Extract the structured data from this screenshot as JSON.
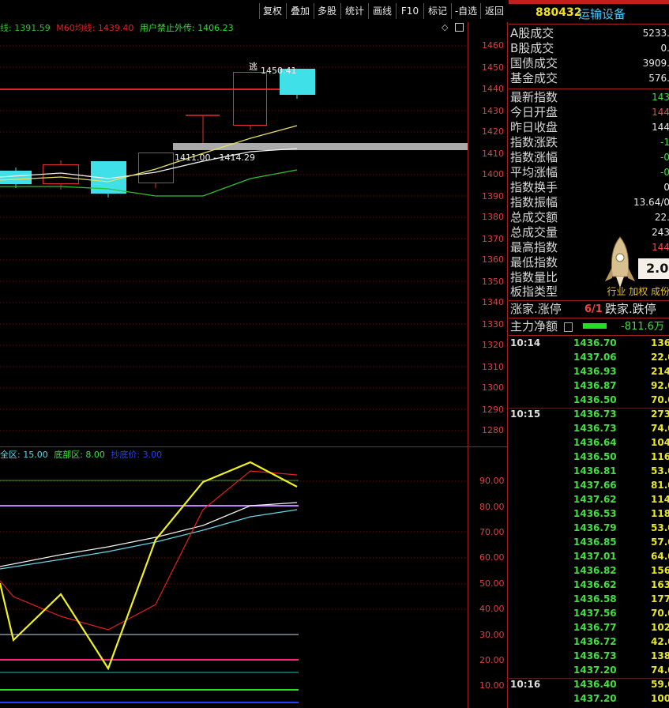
{
  "toolbar": {
    "buttons": [
      "复权",
      "叠加",
      "多股",
      "统计",
      "画线",
      "F10",
      "标记",
      "-自选",
      "返回"
    ]
  },
  "chart_info": {
    "line1_label": "线: 1391.59",
    "line2_label": "M60均线: 1439.40",
    "line3_label": "用户禁止外传: 1406.23",
    "hi_label": "1450.41",
    "zone_label": "1411.00 - 1414.29",
    "escape_label": "逃"
  },
  "indicator_info": {
    "label1": "全区: 15.00",
    "label2": "底部区: 8.00",
    "label3": "抄底价: 3.00"
  },
  "price_axis": [
    "1460",
    "1450",
    "1440",
    "1430",
    "1420",
    "1410",
    "1400",
    "1390",
    "1380",
    "1370",
    "1360",
    "1350",
    "1340",
    "1330",
    "1320",
    "1310",
    "1300",
    "1290",
    "1280"
  ],
  "ind_axis": [
    "90.00",
    "80.00",
    "70.00",
    "60.00",
    "50.00",
    "40.00",
    "30.00",
    "20.00",
    "10.00"
  ],
  "header": {
    "code": "880432",
    "name": "运输设备"
  },
  "stats": [
    {
      "label": "A股成交",
      "value": "5233.",
      "color": "#e8e8e8"
    },
    {
      "label": "B股成交",
      "value": "0.",
      "color": "#e8e8e8"
    },
    {
      "label": "国债成交",
      "value": "3909.",
      "color": "#e8e8e8"
    },
    {
      "label": "基金成交",
      "value": "576.",
      "color": "#e8e8e8"
    },
    {
      "label": "最新指数",
      "value": "143",
      "color": "#40e040"
    },
    {
      "label": "今日开盘",
      "value": "144",
      "color": "#ff4040"
    },
    {
      "label": "昨日收盘",
      "value": "144",
      "color": "#e8e8e8"
    },
    {
      "label": "指数涨跌",
      "value": "-1",
      "color": "#40e040"
    },
    {
      "label": "指数涨幅",
      "value": "-0",
      "color": "#40e040"
    },
    {
      "label": "平均涨幅",
      "value": "-0",
      "color": "#40e040"
    },
    {
      "label": "指数换手",
      "value": "0",
      "color": "#e8e8e8"
    },
    {
      "label": "指数振幅",
      "value": "13.64/0",
      "color": "#e8e8e8"
    },
    {
      "label": "总成交额",
      "value": "22.",
      "color": "#e8e8e8"
    },
    {
      "label": "总成交量",
      "value": "243",
      "color": "#e8e8e8"
    },
    {
      "label": "最高指数",
      "value": "144",
      "color": "#ff4040"
    },
    {
      "label": "最低指数",
      "value": "",
      "color": "#e8e8e8"
    },
    {
      "label": "指数量比",
      "value": "",
      "color": "#e8e8e8"
    }
  ],
  "board_type": {
    "label": "板指类型",
    "value": "行业 加权 成份"
  },
  "badge_value": "2.0",
  "updown": {
    "label1": "涨家.涨停",
    "value": "6/1",
    "label2": "跌家.跌停"
  },
  "netflow": {
    "label": "主力净额",
    "value": "-811.6万"
  },
  "trades": [
    {
      "time": "10:14",
      "price": "1436.70",
      "vol": "136"
    },
    {
      "time": "",
      "price": "1437.06",
      "vol": "22.0"
    },
    {
      "time": "",
      "price": "1436.93",
      "vol": "214"
    },
    {
      "time": "",
      "price": "1436.87",
      "vol": "92.0"
    },
    {
      "time": "",
      "price": "1436.50",
      "vol": "70.0"
    },
    {
      "time": "10:15",
      "price": "1436.73",
      "vol": "273"
    },
    {
      "time": "",
      "price": "1436.73",
      "vol": "74.0"
    },
    {
      "time": "",
      "price": "1436.64",
      "vol": "104"
    },
    {
      "time": "",
      "price": "1436.50",
      "vol": "116"
    },
    {
      "time": "",
      "price": "1436.81",
      "vol": "53.0"
    },
    {
      "time": "",
      "price": "1437.66",
      "vol": "81.0"
    },
    {
      "time": "",
      "price": "1437.62",
      "vol": "114"
    },
    {
      "time": "",
      "price": "1436.53",
      "vol": "118"
    },
    {
      "time": "",
      "price": "1436.79",
      "vol": "53.0"
    },
    {
      "time": "",
      "price": "1436.85",
      "vol": "57.0"
    },
    {
      "time": "",
      "price": "1437.01",
      "vol": "64.0"
    },
    {
      "time": "",
      "price": "1436.82",
      "vol": "156"
    },
    {
      "time": "",
      "price": "1436.62",
      "vol": "163"
    },
    {
      "time": "",
      "price": "1436.58",
      "vol": "177"
    },
    {
      "time": "",
      "price": "1437.56",
      "vol": "70.0"
    },
    {
      "time": "",
      "price": "1436.77",
      "vol": "102"
    },
    {
      "time": "",
      "price": "1436.72",
      "vol": "42.0"
    },
    {
      "time": "",
      "price": "1436.73",
      "vol": "138"
    },
    {
      "time": "",
      "price": "1437.20",
      "vol": "74.0"
    },
    {
      "time": "10:16",
      "price": "1436.40",
      "vol": "59.0"
    },
    {
      "time": "",
      "price": "1437.20",
      "vol": "100"
    }
  ]
}
